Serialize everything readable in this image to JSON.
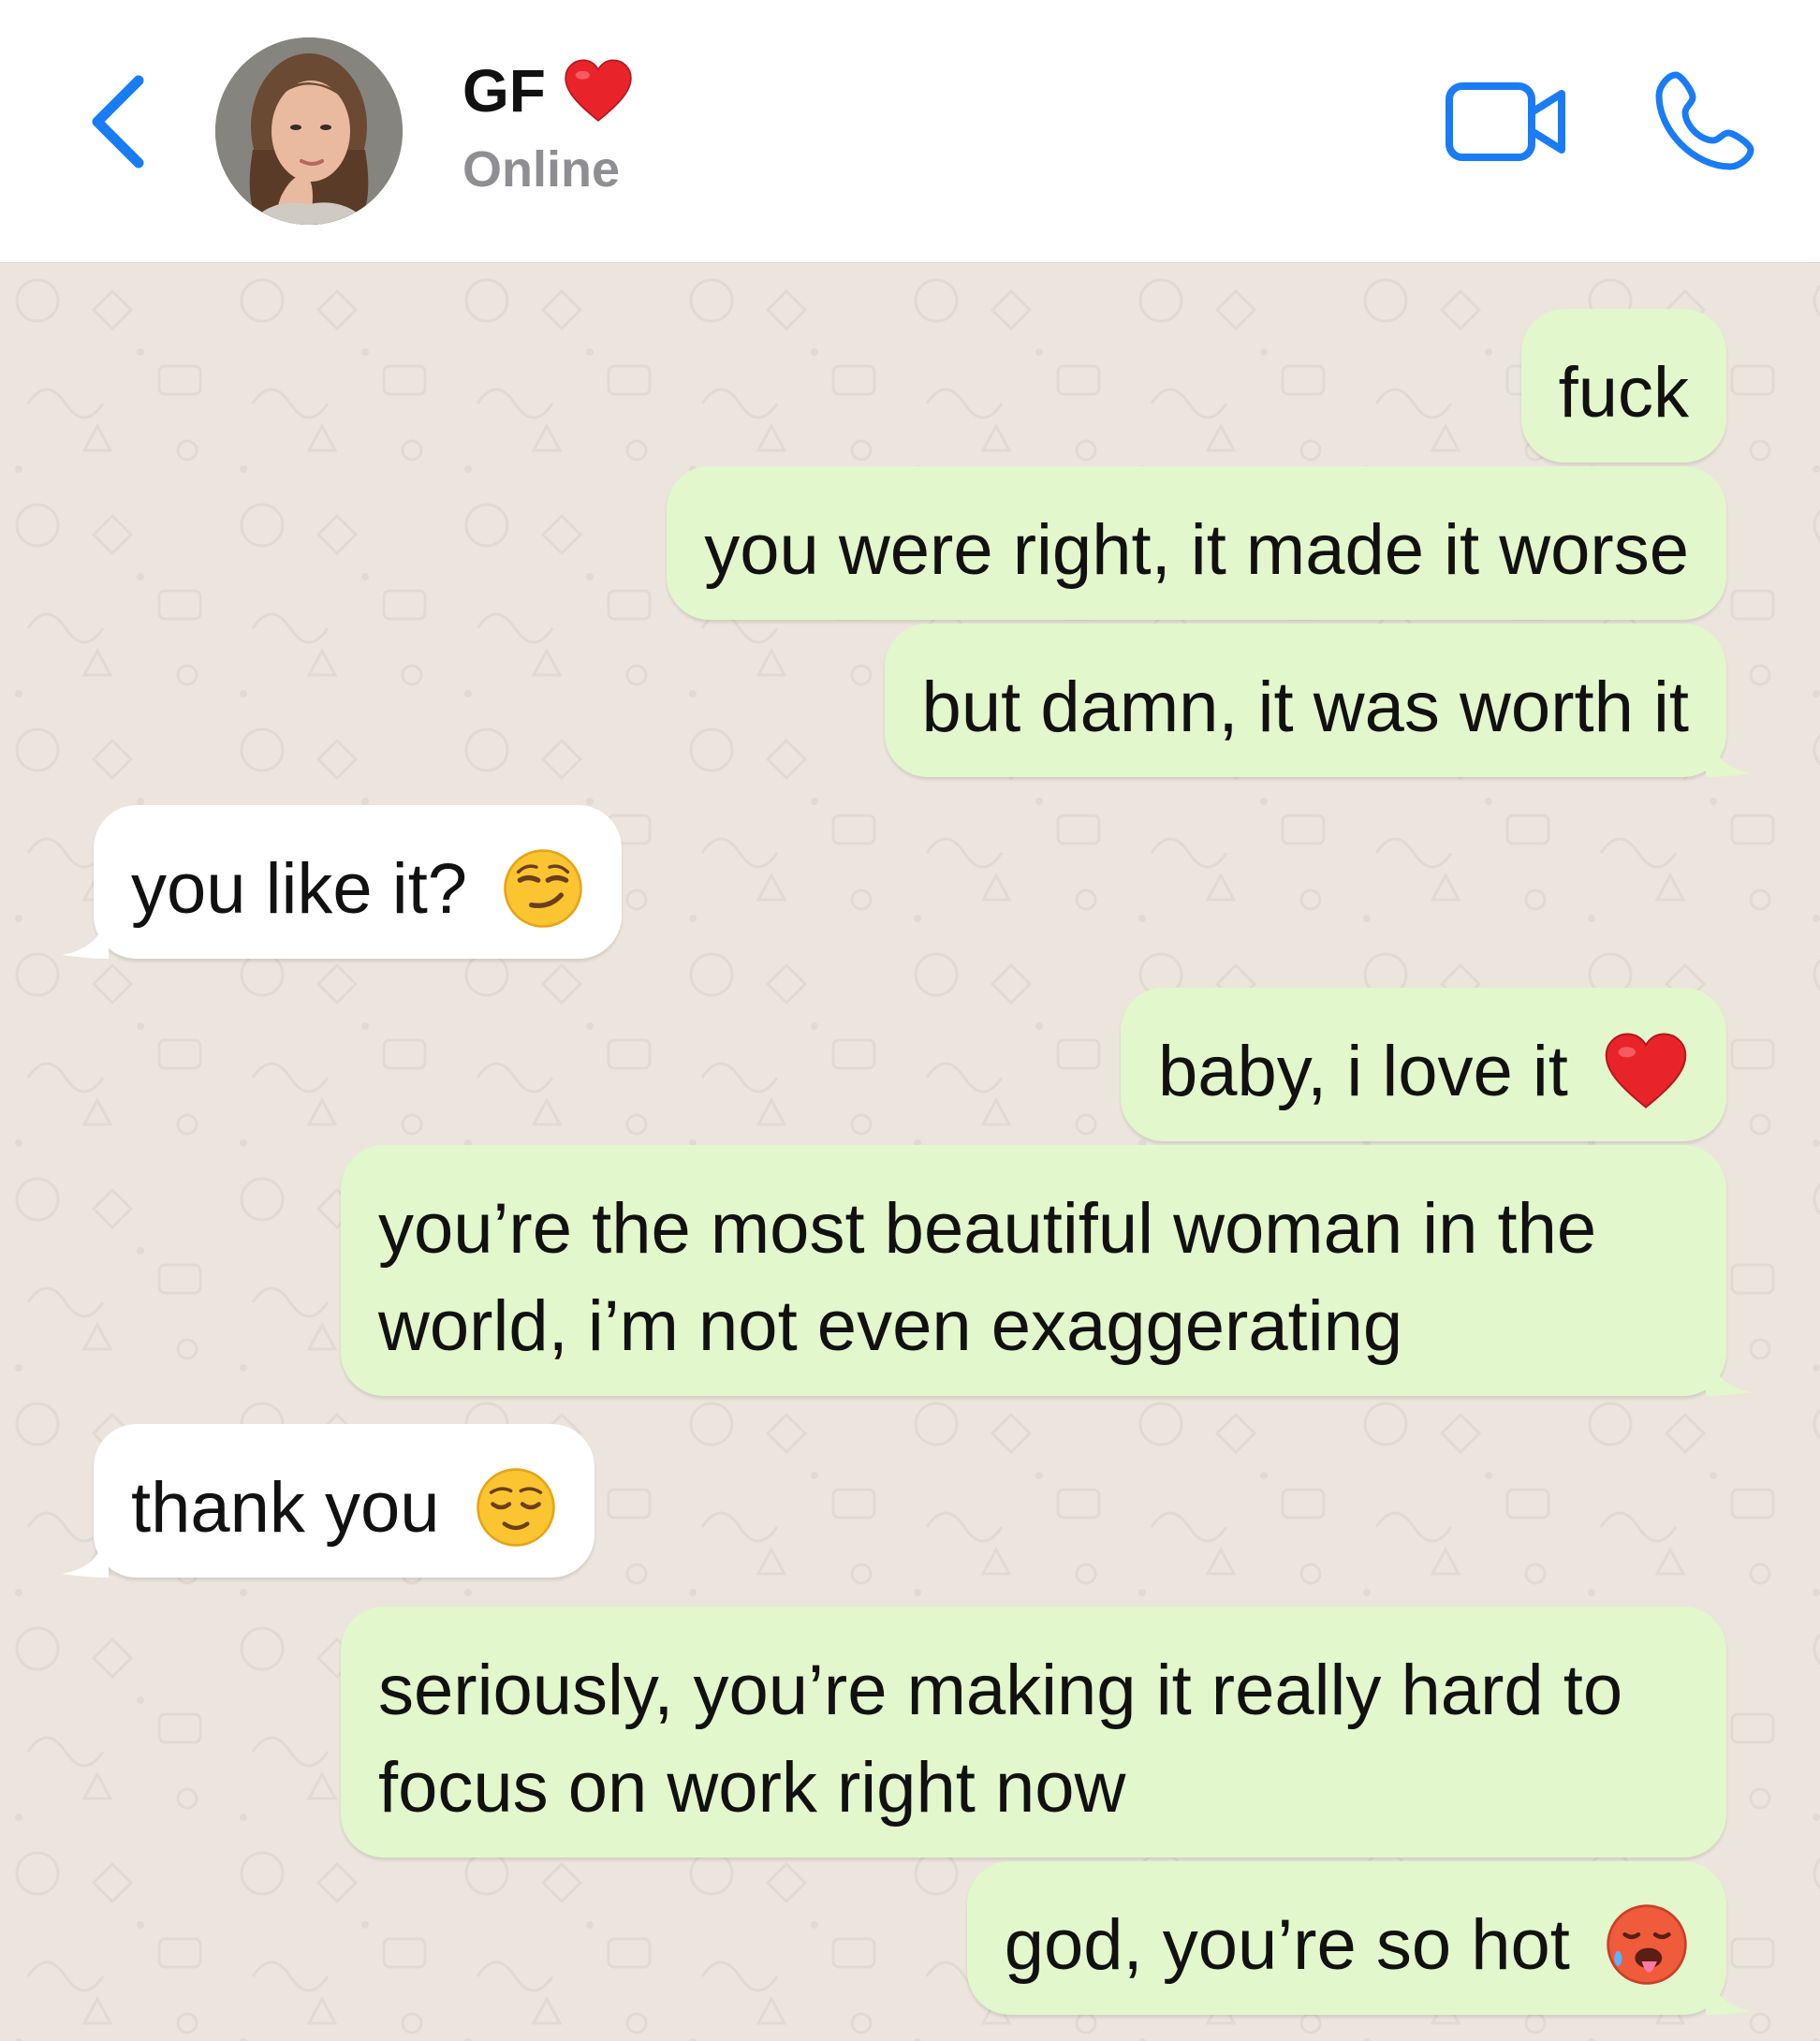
{
  "header": {
    "back_icon": "chevron-left-icon",
    "contact_name": "GF",
    "name_emoji": "red-heart-icon",
    "status": "Online",
    "video_icon": "video-camera-icon",
    "call_icon": "phone-icon"
  },
  "colors": {
    "accent": "#1a7cf5",
    "outgoing_bubble": "#e2f7cb",
    "incoming_bubble": "#ffffff",
    "chat_background": "#ece5dd",
    "status_text": "#8e8e93"
  },
  "messages": [
    {
      "direction": "outgoing",
      "text": "fuck"
    },
    {
      "direction": "outgoing",
      "text": "you were right, it made it worse"
    },
    {
      "direction": "outgoing",
      "text": "but damn, it was worth it"
    },
    {
      "direction": "incoming",
      "text": "you like it?",
      "emoji": "smirking-face-icon"
    },
    {
      "direction": "outgoing",
      "text": "baby, i love it",
      "emoji": "red-heart-icon"
    },
    {
      "direction": "outgoing",
      "text": "you’re the most beautiful woman in the world, i’m not even exaggerating"
    },
    {
      "direction": "incoming",
      "text": "thank you",
      "emoji": "relieved-face-icon"
    },
    {
      "direction": "outgoing",
      "text": "seriously, you’re making it really hard to focus on work right now"
    },
    {
      "direction": "outgoing",
      "text": "god, you’re so hot",
      "emoji": "hot-face-icon"
    }
  ]
}
